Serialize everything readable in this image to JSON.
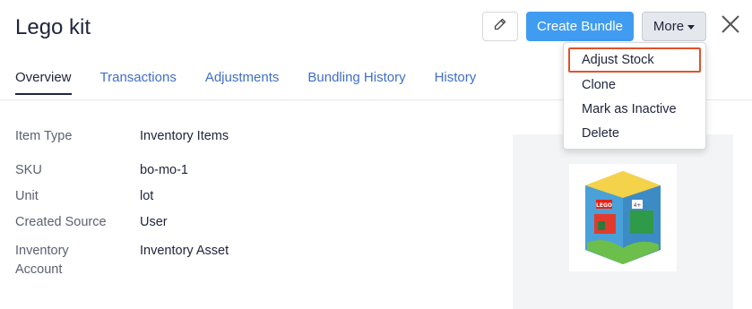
{
  "header": {
    "title": "Lego kit",
    "edit_icon": "pencil-icon",
    "create_label": "Create Bundle",
    "more_label": "More",
    "close_icon": "close-icon"
  },
  "tabs": [
    {
      "label": "Overview",
      "active": true
    },
    {
      "label": "Transactions",
      "active": false
    },
    {
      "label": "Adjustments",
      "active": false
    },
    {
      "label": "Bundling History",
      "active": false
    },
    {
      "label": "History",
      "active": false
    }
  ],
  "details": [
    {
      "label": "Item Type",
      "value": "Inventory Items"
    },
    {
      "label": "SKU",
      "value": "bo-mo-1"
    },
    {
      "label": "Unit",
      "value": "lot"
    },
    {
      "label": "Created Source",
      "value": "User"
    },
    {
      "label": "Inventory Account",
      "value": "Inventory Asset"
    }
  ],
  "more_menu": {
    "items": [
      "Adjust Stock",
      "Clone",
      "Mark as Inactive",
      "Delete"
    ],
    "focused": "Adjust Stock"
  },
  "product_image": {
    "logo_text": "LEGO",
    "age_text": "4+"
  },
  "colors": {
    "primary": "#409cf0",
    "link": "#3f6ec8",
    "focus_outline": "#e0522b",
    "text": "#21263c",
    "muted": "#5b6170"
  }
}
